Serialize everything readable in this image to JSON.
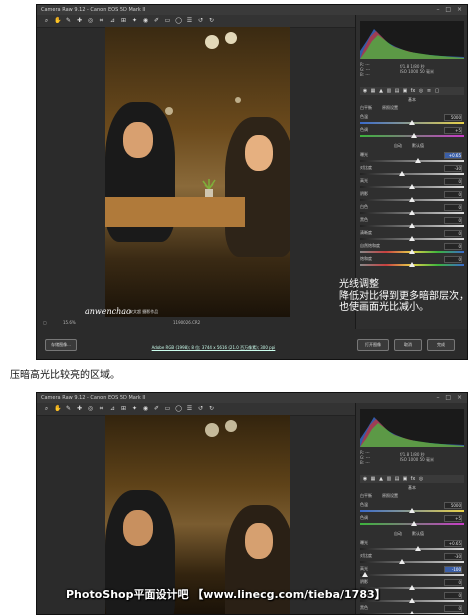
{
  "screenshot1": {
    "title": "Camera Raw 9.12 - Canon EOS 5D Mark II",
    "tools": [
      "zoom-icon",
      "hand-icon",
      "white-balance-icon",
      "color-sampler-icon",
      "target-adjust-icon",
      "crop-icon",
      "straighten-icon",
      "transform-icon",
      "spot-removal-icon",
      "red-eye-icon",
      "adjustment-brush-icon",
      "graduated-filter-icon",
      "radial-filter-icon",
      "preferences-icon",
      "rotate-ccw-icon",
      "rotate-cw-icon"
    ],
    "readout_rgb": [
      "R: ---",
      "G: ---",
      "B: ---"
    ],
    "readout_exif": [
      "f/1.8   1/80 秒",
      "ISO 1000   50 毫米"
    ],
    "panel_title": "基本",
    "white_balance_label": "白平衡",
    "white_balance_value": "原照设置",
    "auto_label": "自动",
    "default_label": "默认值",
    "sliders": [
      {
        "label": "色温",
        "value": "5000",
        "pos": 0.5
      },
      {
        "label": "色调",
        "value": "+5",
        "pos": 0.52
      },
      {
        "label": "曝光",
        "value": "+0.65",
        "pos": 0.56,
        "highlight": true
      },
      {
        "label": "对比度",
        "value": "-30",
        "pos": 0.4
      },
      {
        "label": "高光",
        "value": "0",
        "pos": 0.5
      },
      {
        "label": "阴影",
        "value": "0",
        "pos": 0.5
      },
      {
        "label": "白色",
        "value": "0",
        "pos": 0.5
      },
      {
        "label": "黑色",
        "value": "0",
        "pos": 0.5
      },
      {
        "label": "清晰度",
        "value": "0",
        "pos": 0.5
      },
      {
        "label": "自然饱和度",
        "value": "0",
        "pos": 0.5
      },
      {
        "label": "饱和度",
        "value": "0",
        "pos": 0.5
      }
    ],
    "zoom": "15.6%",
    "filename": "1190026.CR2",
    "workflow_link": "Adobe RGB (1998); 8 位; 3744 x 5616 (21.0 百万像素); 300 ppi",
    "buttons": {
      "save": "存储图像...",
      "open": "打开图像",
      "cancel": "取消",
      "done": "完成"
    },
    "overlay_text": [
      "光线调整",
      "降低对比得到更多暗部层次，",
      "也使画面光比减小。"
    ],
    "signature": "anwenchao",
    "signature_sub": "安文超 摄影作品"
  },
  "caption": "压暗高光比较亮的区域。",
  "screenshot2": {
    "title": "Camera Raw 9.12 - Canon EOS 5D Mark II",
    "readout_rgb": [
      "R: ---",
      "G: ---",
      "B: ---"
    ],
    "readout_exif": [
      "f/1.8   1/80 秒",
      "ISO 1000   50 毫米"
    ],
    "panel_title": "基本",
    "white_balance_label": "白平衡",
    "white_balance_value": "原照设置",
    "auto_label": "自动",
    "default_label": "默认值",
    "sliders": [
      {
        "label": "色温",
        "value": "5000",
        "pos": 0.5
      },
      {
        "label": "色调",
        "value": "+5",
        "pos": 0.52
      },
      {
        "label": "曝光",
        "value": "+0.65",
        "pos": 0.56
      },
      {
        "label": "对比度",
        "value": "-30",
        "pos": 0.4
      },
      {
        "label": "高光",
        "value": "-100",
        "pos": 0.05,
        "highlight": true
      },
      {
        "label": "阴影",
        "value": "0",
        "pos": 0.5
      },
      {
        "label": "白色",
        "value": "0",
        "pos": 0.5
      },
      {
        "label": "黑色",
        "value": "0",
        "pos": 0.5
      }
    ]
  },
  "footer_watermark": "PhotoShop平面设计吧 【www.linecg.com/tieba/1783】"
}
